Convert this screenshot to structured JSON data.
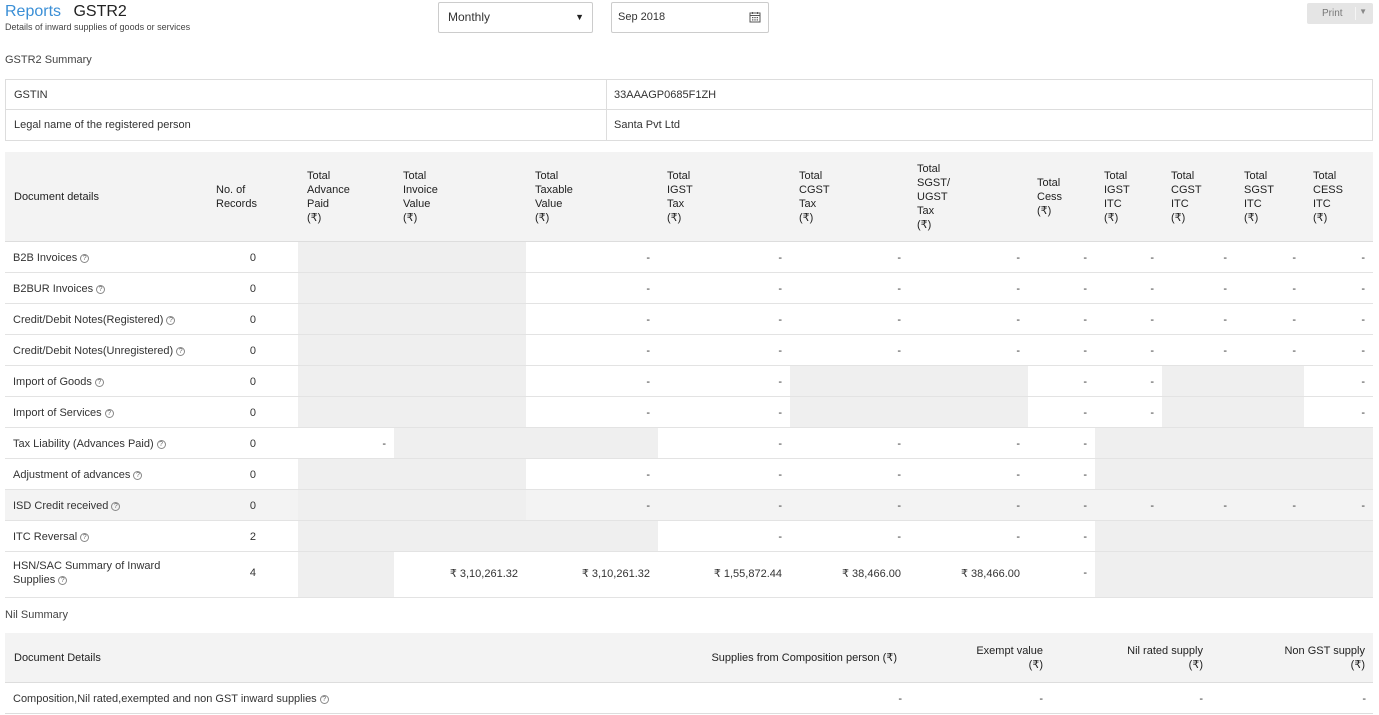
{
  "header": {
    "breadcrumb_reports": "Reports",
    "breadcrumb_current": "GSTR2",
    "subtitle": "Details of inward supplies of goods or services"
  },
  "filters": {
    "period_type": "Monthly",
    "period_value": "Sep 2018"
  },
  "toolbar": {
    "print_label": "Print"
  },
  "summary": {
    "title": "GSTR2 Summary",
    "gstin_label": "GSTIN",
    "gstin_value": "33AAAGP0685F1ZH",
    "legal_name_label": "Legal name of the registered person",
    "legal_name_value": "Santa Pvt Ltd"
  },
  "main_table": {
    "columns": [
      [
        "Document details"
      ],
      [
        "No. of",
        "Records"
      ],
      [
        "Total",
        "Advance",
        "Paid",
        "(₹)"
      ],
      [
        "Total",
        "Invoice",
        "Value",
        "(₹)"
      ],
      [
        "Total",
        "Taxable",
        "Value",
        "(₹)"
      ],
      [
        "Total",
        "IGST",
        "Tax",
        "(₹)"
      ],
      [
        "Total",
        "CGST",
        "Tax",
        "(₹)"
      ],
      [
        "Total",
        "SGST/",
        "UGST",
        "Tax",
        "(₹)"
      ],
      [
        "Total",
        "Cess",
        "(₹)"
      ],
      [
        "Total",
        "IGST",
        "ITC",
        "(₹)"
      ],
      [
        "Total",
        "CGST",
        "ITC",
        "(₹)"
      ],
      [
        "Total",
        "SGST",
        "ITC",
        "(₹)"
      ],
      [
        "Total",
        "CESS",
        "ITC",
        "(₹)"
      ]
    ],
    "rows": [
      {
        "label": "B2B Invoices",
        "records": "0",
        "cells": [
          "",
          "",
          "-",
          "-",
          "-",
          "-",
          "-",
          "-",
          "-",
          "-",
          "-"
        ]
      },
      {
        "label": "B2BUR Invoices",
        "records": "0",
        "cells": [
          "",
          "",
          "-",
          "-",
          "-",
          "-",
          "-",
          "-",
          "-",
          "-",
          "-"
        ]
      },
      {
        "label": "Credit/Debit Notes(Registered)",
        "records": "0",
        "cells": [
          "",
          "",
          "-",
          "-",
          "-",
          "-",
          "-",
          "-",
          "-",
          "-",
          "-"
        ]
      },
      {
        "label": "Credit/Debit Notes(Unregistered)",
        "records": "0",
        "cells": [
          "",
          "",
          "-",
          "-",
          "-",
          "-",
          "-",
          "-",
          "-",
          "-",
          "-"
        ]
      },
      {
        "label": "Import of Goods",
        "records": "0",
        "cells": [
          "",
          "",
          "-",
          "-",
          "",
          "",
          "-",
          "-",
          "",
          "",
          "-"
        ]
      },
      {
        "label": "Import of Services",
        "records": "0",
        "cells": [
          "",
          "",
          "-",
          "-",
          "",
          "",
          "-",
          "-",
          "",
          "",
          "-"
        ]
      },
      {
        "label": "Tax Liability (Advances Paid)",
        "records": "0",
        "cells": [
          "-",
          "",
          "",
          "-",
          "-",
          "-",
          "-",
          "",
          "",
          "",
          ""
        ]
      },
      {
        "label": "Adjustment of advances",
        "records": "0",
        "cells": [
          "",
          "",
          "-",
          "-",
          "-",
          "-",
          "-",
          "",
          "",
          "",
          ""
        ]
      },
      {
        "label": "ISD Credit received",
        "records": "0",
        "cells": [
          "",
          "",
          "-",
          "-",
          "-",
          "-",
          "-",
          "-",
          "-",
          "-",
          "-"
        ]
      },
      {
        "label": "ITC Reversal",
        "records": "2",
        "cells": [
          "",
          "",
          "",
          "-",
          "-",
          "-",
          "-",
          "",
          "",
          "",
          ""
        ]
      },
      {
        "label": "HSN/SAC Summary of Inward Supplies",
        "records": "4",
        "cells": [
          "",
          "₹ 3,10,261.32",
          "₹ 3,10,261.32",
          "₹ 1,55,872.44",
          "₹ 38,466.00",
          "₹ 38,466.00",
          "-",
          "",
          "",
          "",
          ""
        ]
      }
    ]
  },
  "nil_summary": {
    "title": "Nil Summary",
    "col_document": "Document Details",
    "col_composition": "Supplies from Composition person (₹)",
    "col_exempt": "Exempt value",
    "col_nil": "Nil rated supply",
    "col_nongst": "Non GST supply",
    "currency_unit": "(₹)",
    "row_label": "Composition,Nil rated,exempted and non GST inward supplies",
    "row_values": [
      "-",
      "-",
      "-",
      "-"
    ]
  },
  "icons": {
    "help": "help-circle-icon",
    "calendar": "calendar-icon",
    "dropdown": "caret-down-icon"
  },
  "colors": {
    "accent": "#3b8fd6",
    "disabled_cell": "#efefef",
    "header_bg": "#f3f3f3"
  }
}
